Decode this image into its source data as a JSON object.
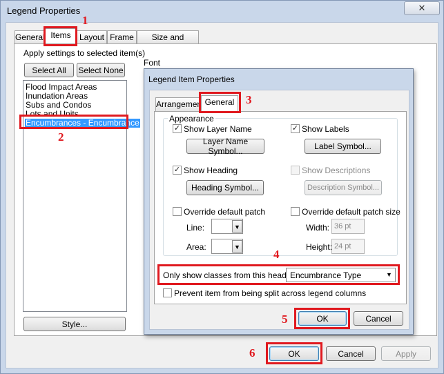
{
  "window": {
    "title": "Legend Properties",
    "close_glyph": "✕"
  },
  "tabs": [
    {
      "label": "General"
    },
    {
      "label": "Items"
    },
    {
      "label": "Layout"
    },
    {
      "label": "Frame"
    },
    {
      "label": "Size and Position"
    }
  ],
  "items_tab": {
    "apply_label": "Apply settings to selected item(s)",
    "select_all": "Select All",
    "select_none": "Select None",
    "list_items": [
      "Flood Impact Areas",
      "Inundation Areas",
      "Subs and Condos",
      "Lots and Units",
      "Encumbrances - Encumbrance"
    ],
    "selected_index": 4,
    "style_button": "Style...",
    "font_label": "Font"
  },
  "footer": {
    "ok": "OK",
    "cancel": "Cancel",
    "apply": "Apply"
  },
  "sub_dialog": {
    "title": "Legend Item Properties",
    "tabs": [
      {
        "label": "Arrangement"
      },
      {
        "label": "General"
      }
    ],
    "appearance_label": "Appearance",
    "show_layer_name": {
      "label": "Show Layer Name",
      "checked": true
    },
    "layer_name_symbol": "Layer Name Symbol...",
    "show_labels": {
      "label": "Show Labels",
      "checked": true
    },
    "label_symbol": "Label Symbol...",
    "show_heading": {
      "label": "Show Heading",
      "checked": true
    },
    "heading_symbol": "Heading Symbol...",
    "show_descriptions": {
      "label": "Show Descriptions",
      "checked": false
    },
    "description_symbol": "Description Symbol...",
    "override_patch": {
      "label": "Override default patch",
      "checked": false
    },
    "line_label": "Line:",
    "area_label": "Area:",
    "override_patch_size": {
      "label": "Override default patch size",
      "checked": false
    },
    "width_label": "Width:",
    "width_value": "36 pt",
    "height_label": "Height:",
    "height_value": "24 pt",
    "heading_filter_label": "Only show classes from this heading:",
    "heading_filter_value": "Encumbrance Type",
    "prevent_split": {
      "label": "Prevent item from being split across legend columns",
      "checked": false
    },
    "ok": "OK",
    "cancel": "Cancel"
  },
  "annotations": [
    "1",
    "2",
    "3",
    "4",
    "5",
    "6"
  ],
  "colors": {
    "highlight": "#e0191f",
    "selection": "#3399ff",
    "frame": "#c9d7ea"
  }
}
